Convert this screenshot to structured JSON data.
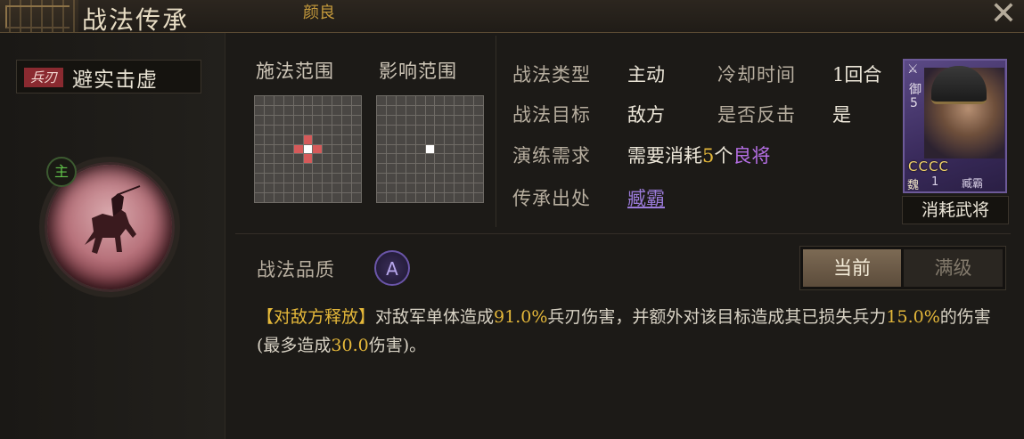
{
  "header": {
    "title": "战法传承",
    "general_name": "颜良",
    "close_symbol": "✕"
  },
  "skill": {
    "type_tag": "兵刃",
    "name": "避实击虚",
    "main_badge": "主"
  },
  "ranges": {
    "cast_label": "施法范围",
    "effect_label": "影响范围"
  },
  "attributes": {
    "type_label": "战法类型",
    "type_value": "主动",
    "cooldown_label": "冷却时间",
    "cooldown_value": "1回合",
    "target_label": "战法目标",
    "target_value": "敌方",
    "counter_label": "是否反击",
    "counter_value": "是",
    "req_label": "演练需求",
    "req_prefix": "需要消耗",
    "req_count": "5",
    "req_unit": "个",
    "req_quality": "良将",
    "source_label": "传承出处",
    "source_value": "臧霸"
  },
  "consume_card": {
    "troop": "御",
    "cost": "5",
    "stars": "CCCC",
    "faction": "魏",
    "level": "1",
    "general": "臧霸",
    "caption": "消耗武将"
  },
  "quality": {
    "label": "战法品质",
    "grade": "A"
  },
  "toggle": {
    "current": "当前",
    "max": "满级"
  },
  "description": {
    "tag": "【对敌方释放】",
    "p1": "对敌军单体造成",
    "v1": "91.0%",
    "p2": "兵刃伤害，并额外对该目标造成其已损失兵力",
    "v2": "15.0%",
    "p3": "的伤害(最多造成",
    "v3": "30.0",
    "p4": "伤害)。"
  },
  "colors": {
    "highlight_yellow": "#e5b83a",
    "highlight_purple": "#b46ee3",
    "range_red": "#d55a5a"
  }
}
